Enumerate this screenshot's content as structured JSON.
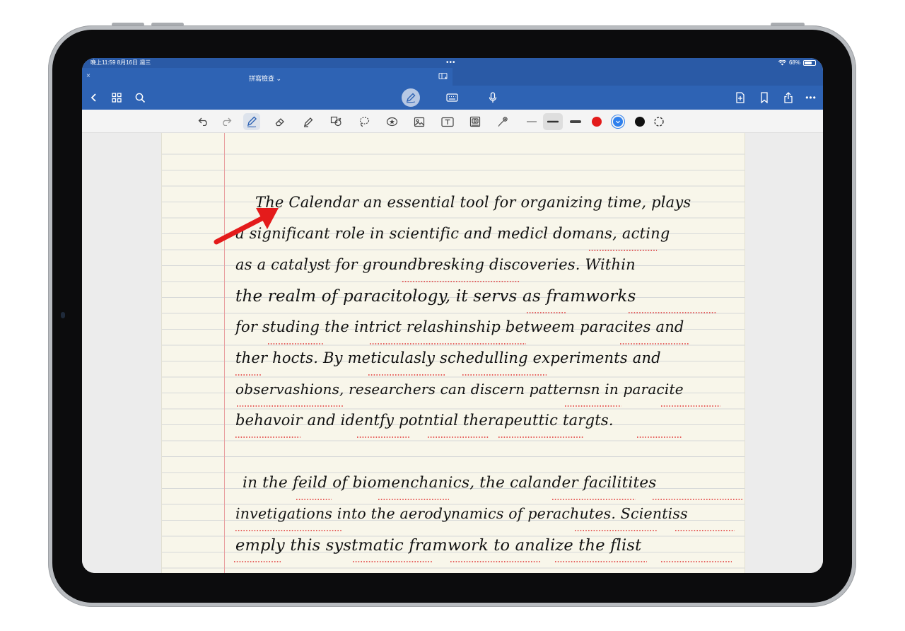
{
  "status_bar": {
    "time_date": "晚上11:59 8月16日 週三",
    "dots": "•••",
    "battery": "68%",
    "battery_level": 0.68
  },
  "tab": {
    "close": "×",
    "title": "拼寫檢查 ⌄"
  },
  "navbar": {
    "left_icons": [
      "chevron-left-icon",
      "grid-icon",
      "search-icon"
    ],
    "center_icons": [
      "pen-mode-icon",
      "keyboard-icon",
      "microphone-icon"
    ],
    "right_icons": [
      "add-page-icon",
      "bookmark-icon",
      "share-icon",
      "more-icon"
    ],
    "more": "•••"
  },
  "toolbar": {
    "tools": [
      "undo-icon",
      "redo-icon",
      "pen-icon",
      "eraser-icon",
      "highlighter-icon",
      "shapes-icon",
      "lasso-icon",
      "sticker-icon",
      "image-icon",
      "text-icon",
      "camera-icon",
      "laser-pointer-icon"
    ],
    "thickness": [
      "thin",
      "medium",
      "thick"
    ],
    "colors": [
      "#e31b1b",
      "#2f80ed",
      "#111111"
    ]
  },
  "note": {
    "lines": [
      "The Calendar an essential tool for organizing time, plays",
      "a significant role in scientific and medicl domans, acting",
      "as a catalyst for groundbresking discoveries. Within",
      "the realm of paracitology, it servs as framworks",
      "for studing the intrict relashinship betweem paracites and",
      "ther hocts. By meticulasly schedulling experiments and",
      "observashions, researchers can discern patternsn in paracite",
      "behavoir and identfy potntial therapeuttic targts.",
      "in the feild of biomenchanics, the calander facilitites",
      "invetigations into the aerodynamics of perachutes. Scientiss",
      "emply this systmatic framwork to analize the flist"
    ]
  }
}
